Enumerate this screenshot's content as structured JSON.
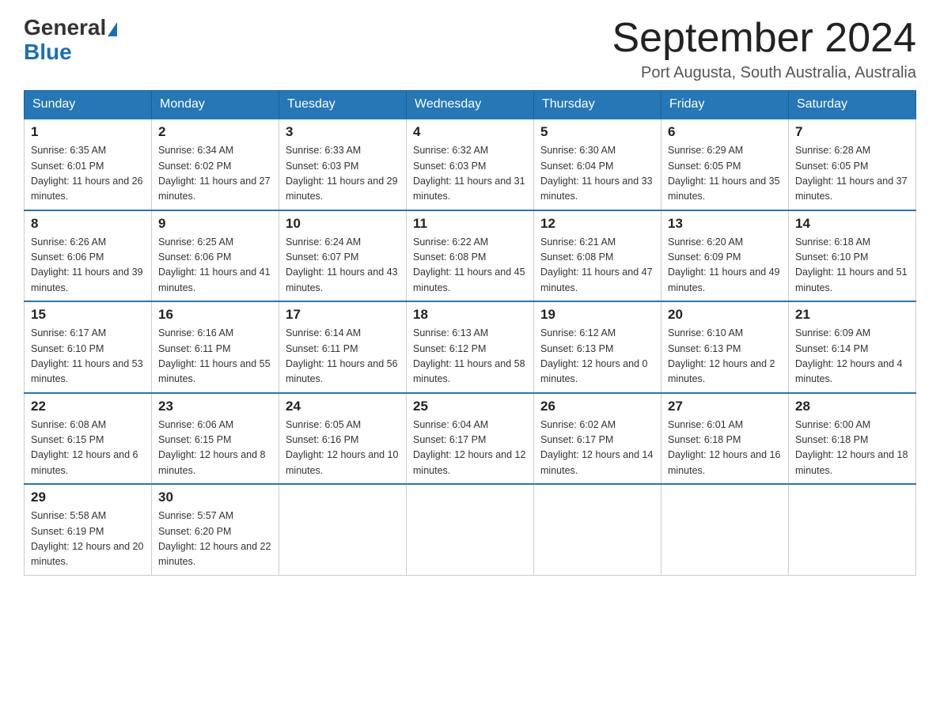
{
  "header": {
    "logo_general": "General",
    "logo_blue": "Blue",
    "month_title": "September 2024",
    "location": "Port Augusta, South Australia, Australia"
  },
  "weekdays": [
    "Sunday",
    "Monday",
    "Tuesday",
    "Wednesday",
    "Thursday",
    "Friday",
    "Saturday"
  ],
  "weeks": [
    [
      {
        "day": "1",
        "sunrise": "6:35 AM",
        "sunset": "6:01 PM",
        "daylight": "11 hours and 26 minutes."
      },
      {
        "day": "2",
        "sunrise": "6:34 AM",
        "sunset": "6:02 PM",
        "daylight": "11 hours and 27 minutes."
      },
      {
        "day": "3",
        "sunrise": "6:33 AM",
        "sunset": "6:03 PM",
        "daylight": "11 hours and 29 minutes."
      },
      {
        "day": "4",
        "sunrise": "6:32 AM",
        "sunset": "6:03 PM",
        "daylight": "11 hours and 31 minutes."
      },
      {
        "day": "5",
        "sunrise": "6:30 AM",
        "sunset": "6:04 PM",
        "daylight": "11 hours and 33 minutes."
      },
      {
        "day": "6",
        "sunrise": "6:29 AM",
        "sunset": "6:05 PM",
        "daylight": "11 hours and 35 minutes."
      },
      {
        "day": "7",
        "sunrise": "6:28 AM",
        "sunset": "6:05 PM",
        "daylight": "11 hours and 37 minutes."
      }
    ],
    [
      {
        "day": "8",
        "sunrise": "6:26 AM",
        "sunset": "6:06 PM",
        "daylight": "11 hours and 39 minutes."
      },
      {
        "day": "9",
        "sunrise": "6:25 AM",
        "sunset": "6:06 PM",
        "daylight": "11 hours and 41 minutes."
      },
      {
        "day": "10",
        "sunrise": "6:24 AM",
        "sunset": "6:07 PM",
        "daylight": "11 hours and 43 minutes."
      },
      {
        "day": "11",
        "sunrise": "6:22 AM",
        "sunset": "6:08 PM",
        "daylight": "11 hours and 45 minutes."
      },
      {
        "day": "12",
        "sunrise": "6:21 AM",
        "sunset": "6:08 PM",
        "daylight": "11 hours and 47 minutes."
      },
      {
        "day": "13",
        "sunrise": "6:20 AM",
        "sunset": "6:09 PM",
        "daylight": "11 hours and 49 minutes."
      },
      {
        "day": "14",
        "sunrise": "6:18 AM",
        "sunset": "6:10 PM",
        "daylight": "11 hours and 51 minutes."
      }
    ],
    [
      {
        "day": "15",
        "sunrise": "6:17 AM",
        "sunset": "6:10 PM",
        "daylight": "11 hours and 53 minutes."
      },
      {
        "day": "16",
        "sunrise": "6:16 AM",
        "sunset": "6:11 PM",
        "daylight": "11 hours and 55 minutes."
      },
      {
        "day": "17",
        "sunrise": "6:14 AM",
        "sunset": "6:11 PM",
        "daylight": "11 hours and 56 minutes."
      },
      {
        "day": "18",
        "sunrise": "6:13 AM",
        "sunset": "6:12 PM",
        "daylight": "11 hours and 58 minutes."
      },
      {
        "day": "19",
        "sunrise": "6:12 AM",
        "sunset": "6:13 PM",
        "daylight": "12 hours and 0 minutes."
      },
      {
        "day": "20",
        "sunrise": "6:10 AM",
        "sunset": "6:13 PM",
        "daylight": "12 hours and 2 minutes."
      },
      {
        "day": "21",
        "sunrise": "6:09 AM",
        "sunset": "6:14 PM",
        "daylight": "12 hours and 4 minutes."
      }
    ],
    [
      {
        "day": "22",
        "sunrise": "6:08 AM",
        "sunset": "6:15 PM",
        "daylight": "12 hours and 6 minutes."
      },
      {
        "day": "23",
        "sunrise": "6:06 AM",
        "sunset": "6:15 PM",
        "daylight": "12 hours and 8 minutes."
      },
      {
        "day": "24",
        "sunrise": "6:05 AM",
        "sunset": "6:16 PM",
        "daylight": "12 hours and 10 minutes."
      },
      {
        "day": "25",
        "sunrise": "6:04 AM",
        "sunset": "6:17 PM",
        "daylight": "12 hours and 12 minutes."
      },
      {
        "day": "26",
        "sunrise": "6:02 AM",
        "sunset": "6:17 PM",
        "daylight": "12 hours and 14 minutes."
      },
      {
        "day": "27",
        "sunrise": "6:01 AM",
        "sunset": "6:18 PM",
        "daylight": "12 hours and 16 minutes."
      },
      {
        "day": "28",
        "sunrise": "6:00 AM",
        "sunset": "6:18 PM",
        "daylight": "12 hours and 18 minutes."
      }
    ],
    [
      {
        "day": "29",
        "sunrise": "5:58 AM",
        "sunset": "6:19 PM",
        "daylight": "12 hours and 20 minutes."
      },
      {
        "day": "30",
        "sunrise": "5:57 AM",
        "sunset": "6:20 PM",
        "daylight": "12 hours and 22 minutes."
      },
      null,
      null,
      null,
      null,
      null
    ]
  ]
}
